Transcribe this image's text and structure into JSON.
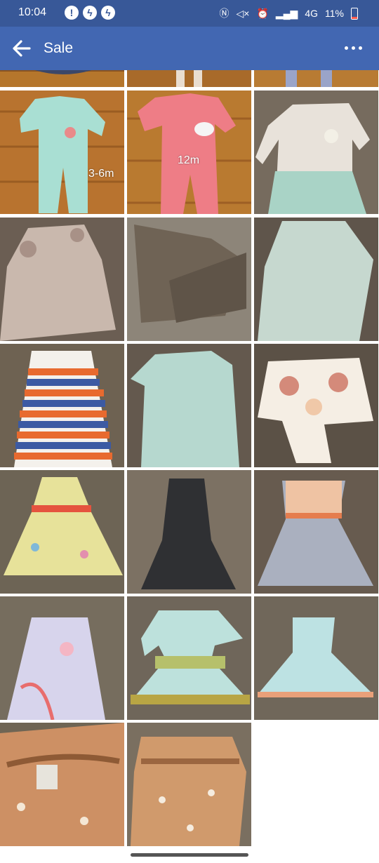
{
  "status": {
    "time": "10:04",
    "network": "4G",
    "battery": "11%"
  },
  "header": {
    "title": "Sale"
  },
  "photos": [
    {
      "label": ""
    },
    {
      "label": "3-6m"
    },
    {
      "label": "12m"
    }
  ],
  "colors": {
    "header": "#4267b2",
    "status_bar": "#385898"
  }
}
